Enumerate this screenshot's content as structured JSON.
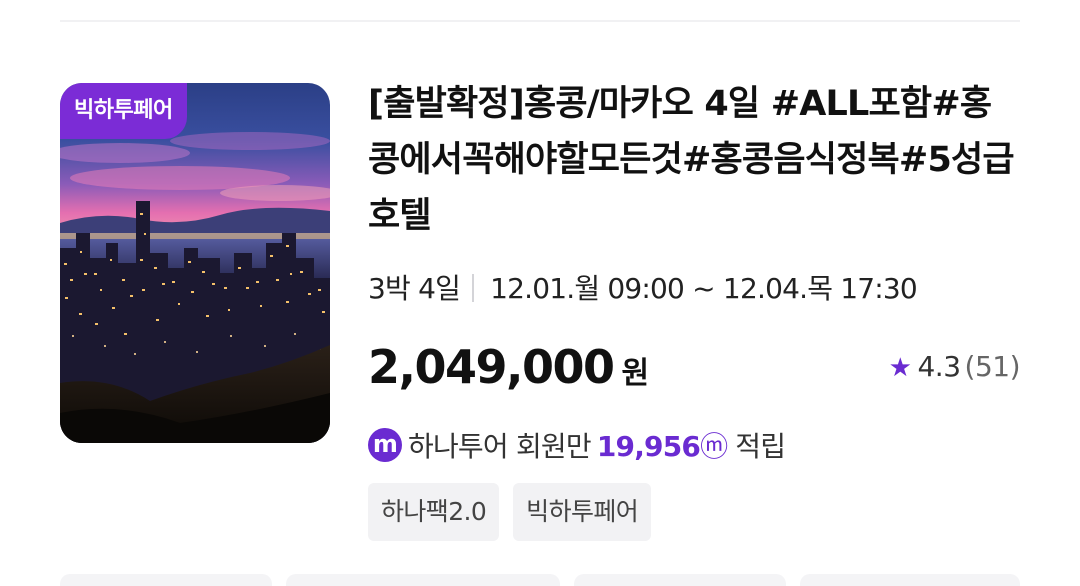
{
  "product": {
    "badge": "빅하투페어",
    "title": "[출발확정]홍콩/마카오 4일 #ALL포함#홍콩에서꼭해야할모든것#홍콩음식정복#5성급호텔",
    "duration": "3박 4일",
    "dates": "12.01.월 09:00 ~ 12.04.목 17:30",
    "price": "2,049,000",
    "price_unit": "원",
    "rating": "4.3",
    "review_count": "(51)",
    "points_icon_letter": "m",
    "points_label": "하나투어 회원만",
    "points_amount": "19,956",
    "points_unit": "ⓜ",
    "points_suffix": "적립",
    "tags": [
      "하나팩2.0",
      "빅하투페어"
    ]
  },
  "colors": {
    "accent": "#6a2bd1",
    "badge_bg": "#7b2cd6",
    "tag_bg": "#f2f2f4"
  },
  "icons": {
    "rating": "star-icon",
    "points": "mileage-m-icon"
  }
}
